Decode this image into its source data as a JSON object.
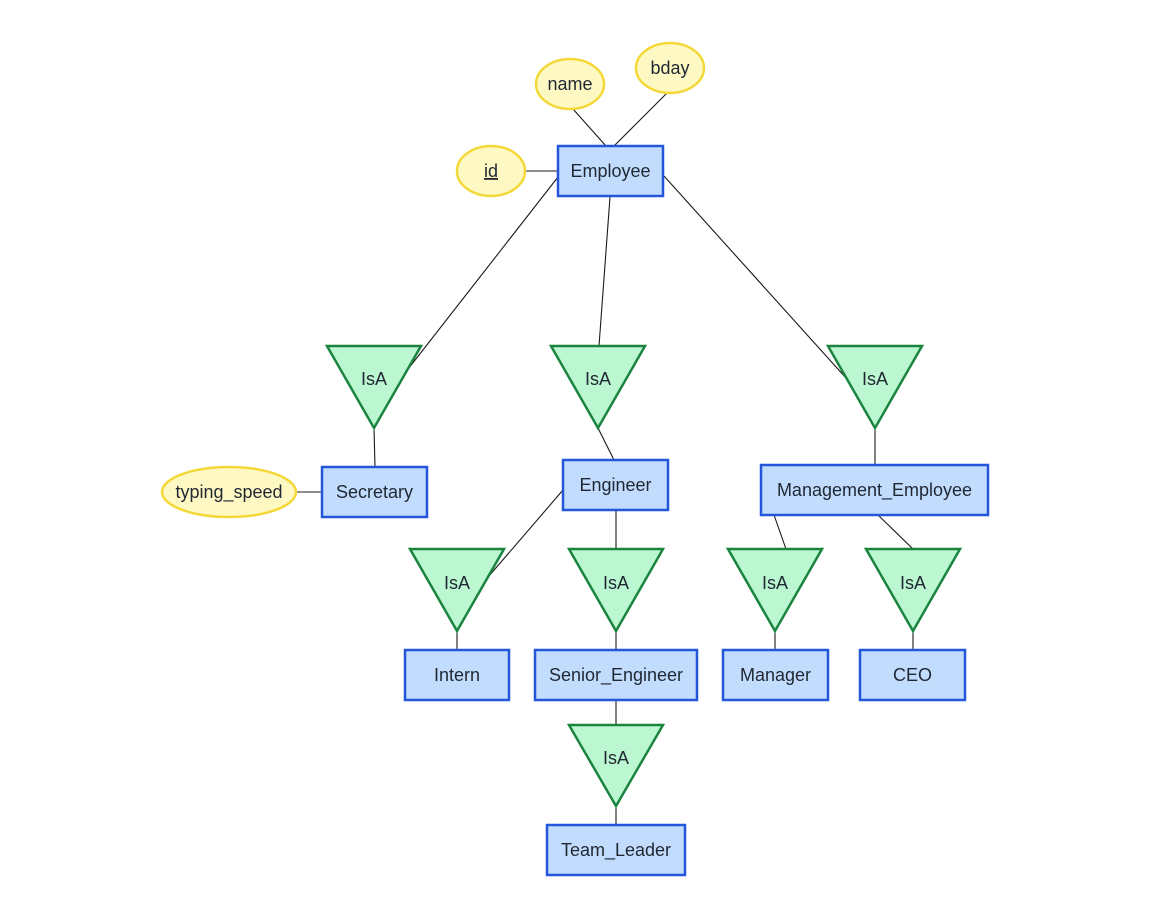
{
  "diagram": {
    "type": "ER diagram (specialization hierarchy)",
    "colors": {
      "entity_fill": "#c2dcfd",
      "entity_stroke": "#2356d8",
      "attribute_fill": "#fef9c3",
      "attribute_stroke": "#f4d83a",
      "isa_fill": "#bbf7d0",
      "isa_stroke": "#1b8540"
    },
    "entities": {
      "employee": "Employee",
      "secretary": "Secretary",
      "engineer": "Engineer",
      "management_employee": "Management_Employee",
      "intern": "Intern",
      "senior_engineer": "Senior_Engineer",
      "manager": "Manager",
      "ceo": "CEO",
      "team_leader": "Team_Leader"
    },
    "attributes": {
      "id": {
        "label": "id",
        "key": true,
        "owner": "Employee"
      },
      "name": {
        "label": "name",
        "key": false,
        "owner": "Employee"
      },
      "bday": {
        "label": "bday",
        "key": false,
        "owner": "Employee"
      },
      "typing_speed": {
        "label": "typing_speed",
        "key": false,
        "owner": "Secretary"
      }
    },
    "isa_label": "IsA",
    "isa_relations": [
      {
        "parent": "Employee",
        "child": "Secretary"
      },
      {
        "parent": "Employee",
        "child": "Engineer"
      },
      {
        "parent": "Employee",
        "child": "Management_Employee"
      },
      {
        "parent": "Engineer",
        "child": "Intern"
      },
      {
        "parent": "Engineer",
        "child": "Senior_Engineer"
      },
      {
        "parent": "Management_Employee",
        "child": "Manager"
      },
      {
        "parent": "Management_Employee",
        "child": "CEO"
      },
      {
        "parent": "Senior_Engineer",
        "child": "Team_Leader"
      }
    ]
  }
}
